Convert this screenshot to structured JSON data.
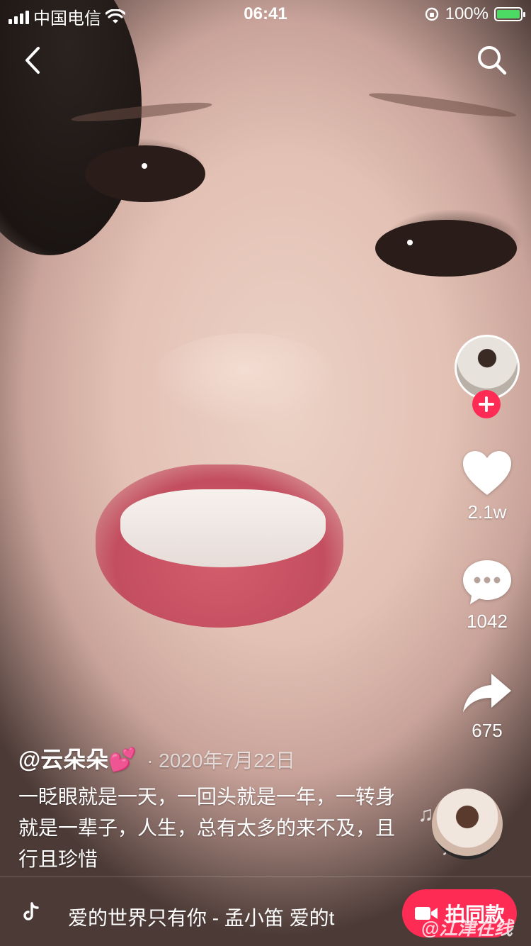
{
  "status_bar": {
    "carrier": "中国电信",
    "time": "06:41",
    "battery": "100%",
    "battery_level": 1.0
  },
  "nav": {
    "back_icon": "chevron-left-icon",
    "search_icon": "search-icon"
  },
  "right_rail": {
    "likes": "2.1w",
    "comments": "1042",
    "shares": "675"
  },
  "post": {
    "author": "@云朵朵💕",
    "date": "· 2020年7月22日",
    "description": "一眨眼就是一天，一回头就是一年，一转身就是一辈子，人生，总有太多的来不及，且行且珍惜"
  },
  "music_bar": {
    "title": "爱的世界只有你 - 孟小笛   爱的t",
    "shoot_label": "拍同款",
    "watermark": "@江津在线"
  },
  "colors": {
    "accent": "#fe2c55",
    "battery_green": "#4cd964"
  }
}
